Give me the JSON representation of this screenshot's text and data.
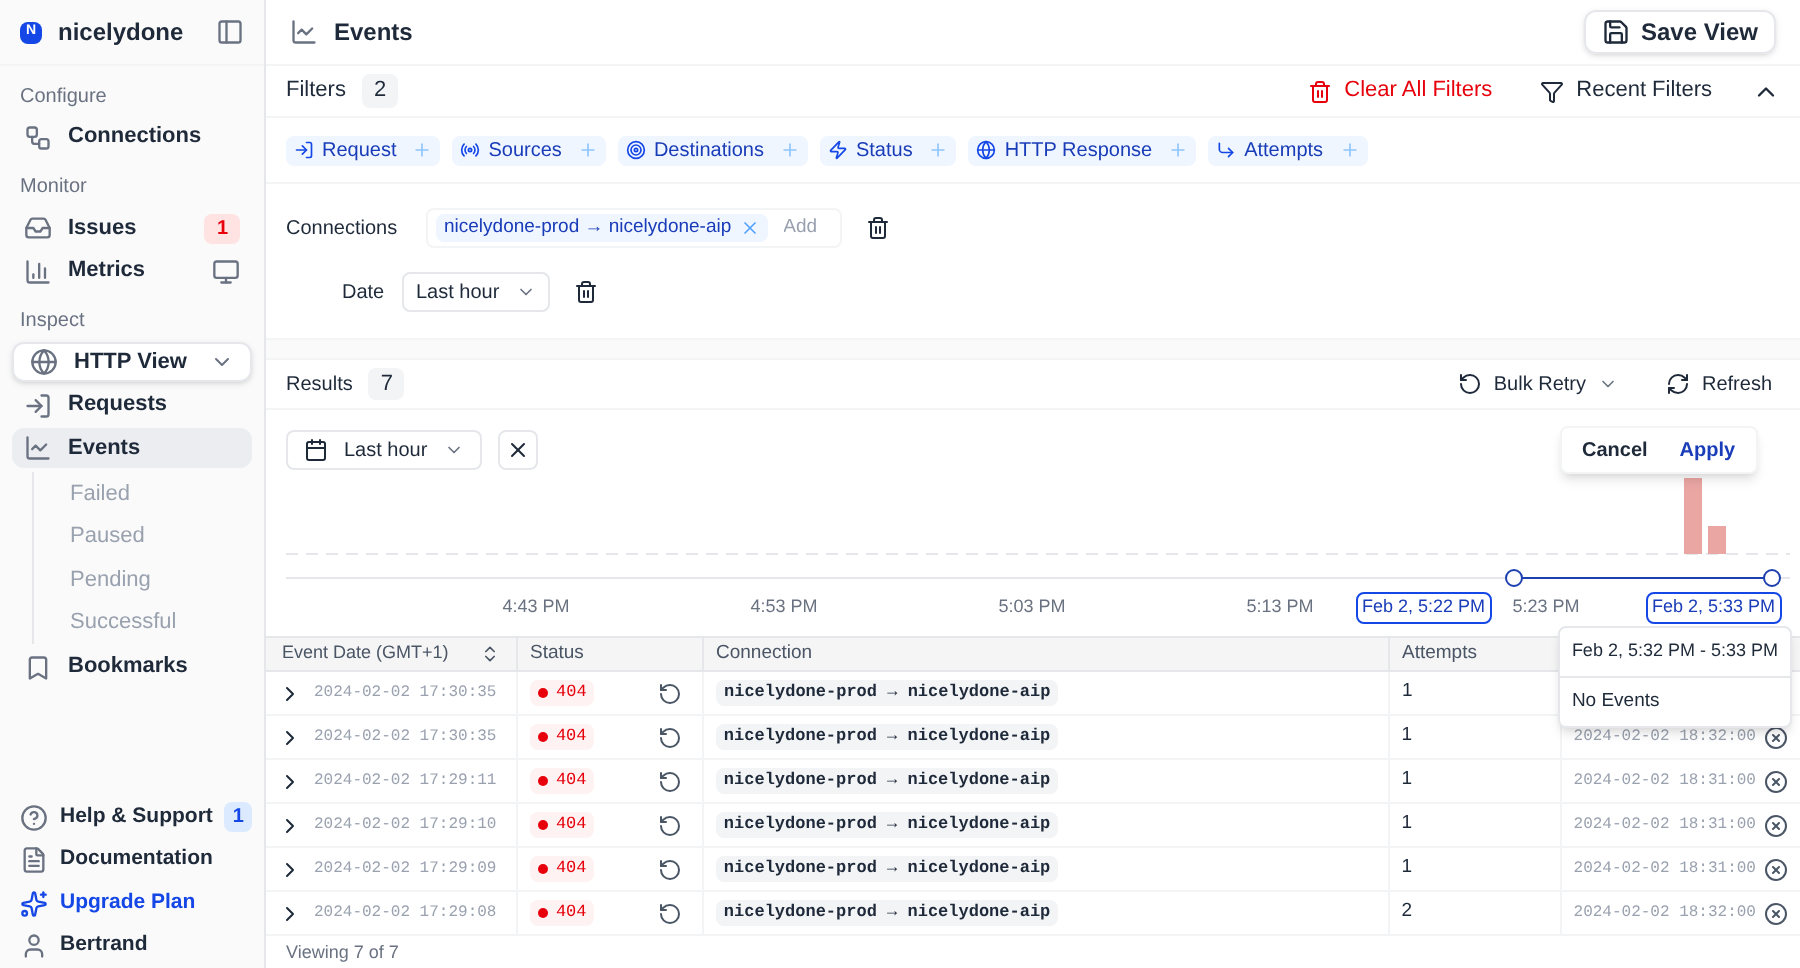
{
  "workspace": {
    "initial": "N",
    "name": "nicelydone"
  },
  "sidebar": {
    "sections": [
      {
        "label": "Configure",
        "items": [
          {
            "kind": "link",
            "label": "Connections",
            "selected": false
          }
        ]
      },
      {
        "label": "Monitor",
        "items": [
          {
            "kind": "link",
            "label": "Issues",
            "badge": "1",
            "selected": false
          },
          {
            "kind": "link",
            "label": "Metrics",
            "selected": false
          }
        ]
      },
      {
        "label": "Inspect",
        "items": [
          {
            "kind": "dropdown",
            "label": "HTTP View"
          },
          {
            "kind": "link",
            "label": "Requests",
            "selected": false
          },
          {
            "kind": "link",
            "label": "Events",
            "selected": true,
            "children": [
              {
                "label": "Failed"
              },
              {
                "label": "Paused"
              },
              {
                "label": "Pending"
              },
              {
                "label": "Successful"
              }
            ]
          },
          {
            "kind": "link",
            "label": "Bookmarks",
            "selected": false
          }
        ]
      }
    ],
    "footer": [
      {
        "kind": "link",
        "label": "Help & Support",
        "badge": "1"
      },
      {
        "kind": "link",
        "label": "Documentation"
      },
      {
        "kind": "upgrade",
        "label": "Upgrade Plan"
      },
      {
        "kind": "user",
        "label": "Bertrand"
      }
    ]
  },
  "page": {
    "title": "Events",
    "save_button": "Save View"
  },
  "filters": {
    "label": "Filters",
    "count": "2",
    "clear": "Clear All Filters",
    "recent": "Recent Filters",
    "expanded": true,
    "chips": [
      {
        "label": "Request"
      },
      {
        "label": "Sources"
      },
      {
        "label": "Destinations"
      },
      {
        "label": "Status"
      },
      {
        "label": "HTTP Response"
      },
      {
        "label": "Attempts"
      }
    ],
    "connections": {
      "label": "Connections",
      "value": "nicelydone-prod → nicelydone-aip",
      "placeholder": "Add"
    },
    "date": {
      "label": "Date",
      "value": "Last hour"
    }
  },
  "results": {
    "label": "Results",
    "count": "7",
    "bulk_retry": "Bulk Retry",
    "refresh": "Refresh",
    "range_button": "Last hour",
    "popover": {
      "cancel": "Cancel",
      "apply": "Apply"
    },
    "chart": {
      "x_labels": [
        "4:43 PM",
        "4:53 PM",
        "5:03 PM",
        "5:13 PM",
        "5:23 PM"
      ],
      "range_start": "Feb 2, 5:22 PM",
      "range_end": "Feb 2, 5:33 PM"
    },
    "tooltip": {
      "title": "Feb 2, 5:32 PM - 5:33 PM",
      "body": "No Events"
    }
  },
  "table": {
    "columns": [
      "Event Date (GMT+1)",
      "Status",
      "Connection",
      "Attempts"
    ],
    "rows": [
      {
        "date": "2024-02-02 17:30:35",
        "status": "404",
        "connection": "nicelydone-prod → nicelydone-aip",
        "attempts": "1"
      },
      {
        "date": "2024-02-02 17:30:35",
        "status": "404",
        "connection": "nicelydone-prod → nicelydone-aip",
        "attempts": "1",
        "column_5": "2024-02-02 18:32:00"
      },
      {
        "date": "2024-02-02 17:29:11",
        "status": "404",
        "connection": "nicelydone-prod → nicelydone-aip",
        "attempts": "1",
        "column_5": "2024-02-02 18:31:00"
      },
      {
        "date": "2024-02-02 17:29:10",
        "status": "404",
        "connection": "nicelydone-prod → nicelydone-aip",
        "attempts": "1",
        "column_5": "2024-02-02 18:31:00"
      },
      {
        "date": "2024-02-02 17:29:09",
        "status": "404",
        "connection": "nicelydone-prod → nicelydone-aip",
        "attempts": "1",
        "column_5": "2024-02-02 18:31:00"
      },
      {
        "date": "2024-02-02 17:29:08",
        "status": "404",
        "connection": "nicelydone-prod → nicelydone-aip",
        "attempts": "2",
        "column_5": "2024-02-02 18:32:00"
      }
    ],
    "footer": "Viewing 7 of 7"
  }
}
